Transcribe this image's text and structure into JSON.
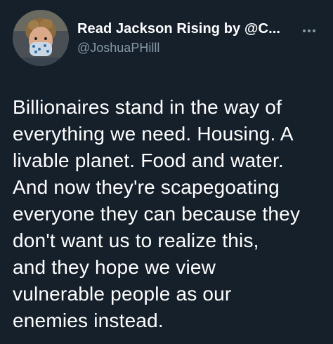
{
  "header": {
    "display_name": "Read Jackson Rising by @C...",
    "handle": "@JoshuaPHilll",
    "avatar_icon": "profile-photo-avatar",
    "more_icon": "more-options-icon"
  },
  "tweet": {
    "text": "Billionaires stand in the way of\neverything we need. Housing. A\nlivable planet. Food and water.\nAnd now they're scapegoating\neveryone they can because they\ndon't want us to realize this,\nand they hope we view\nvulnerable people as our\nenemies instead."
  },
  "colors": {
    "background": "#15202b",
    "primary_text": "#ffffff",
    "secondary_text": "#8899a6"
  }
}
